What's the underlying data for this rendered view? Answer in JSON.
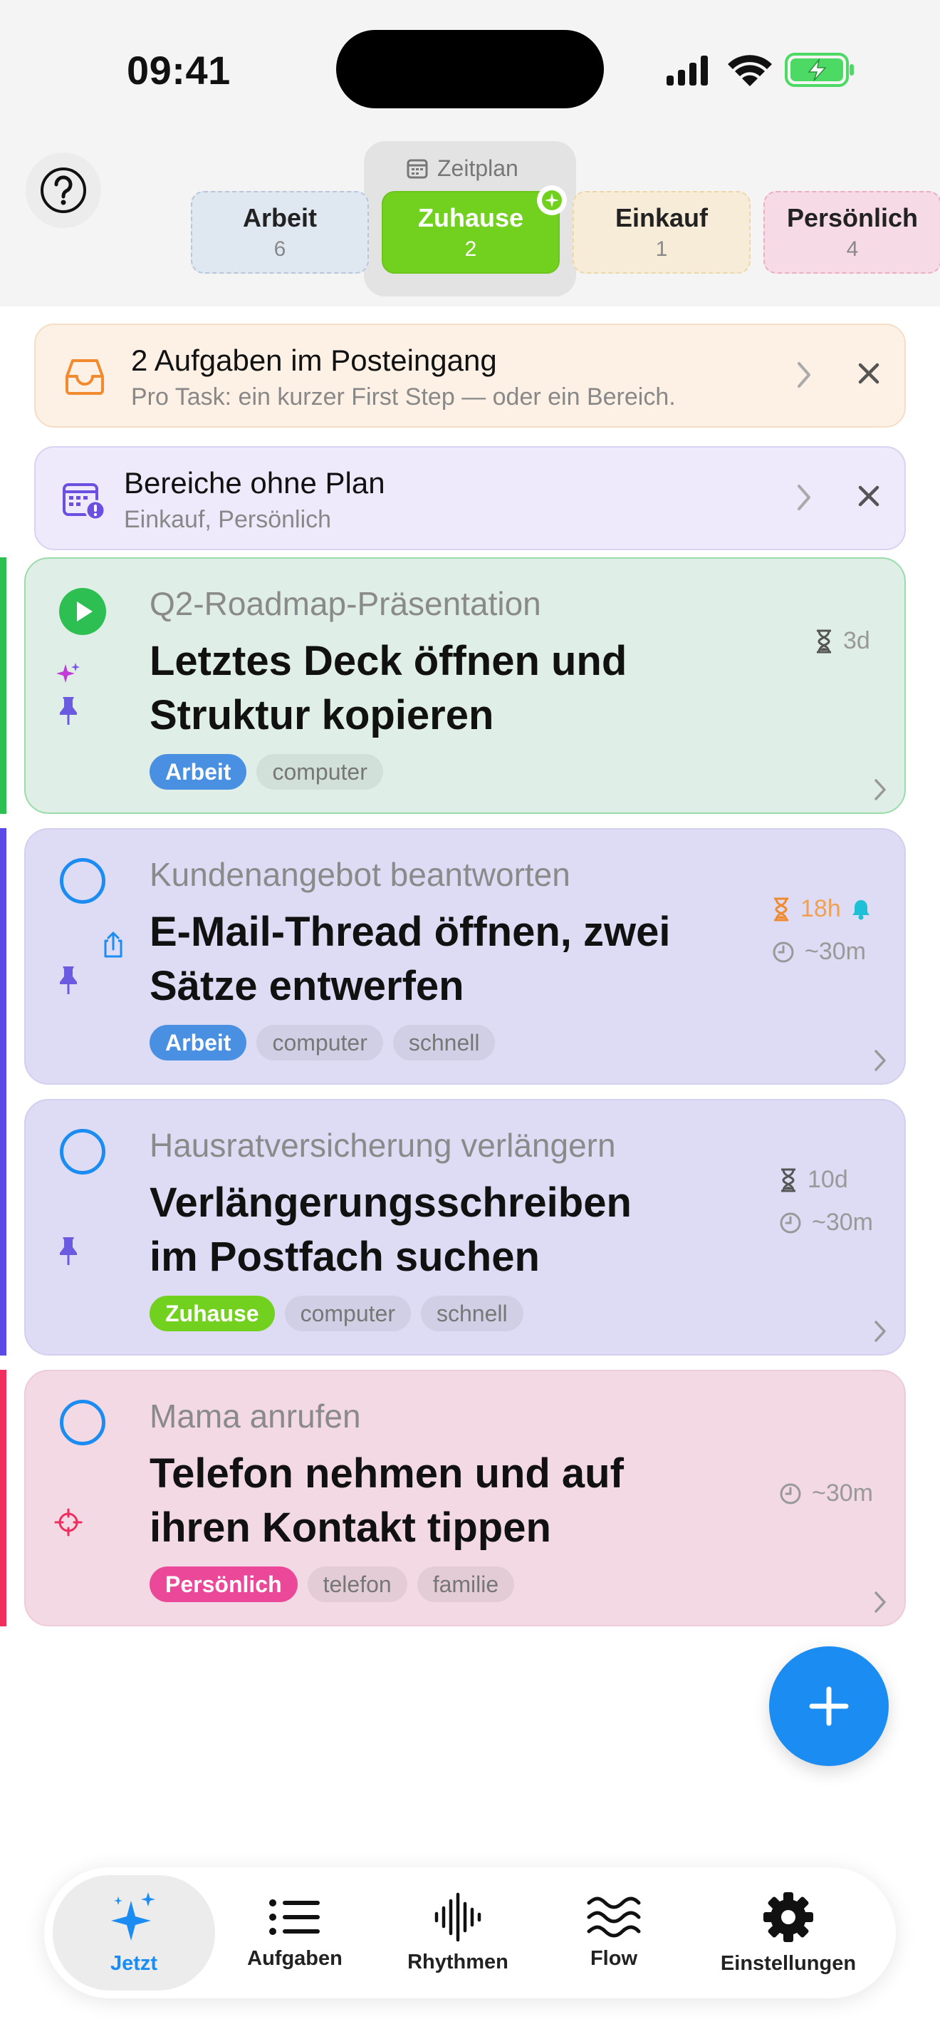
{
  "status_bar": {
    "time": "09:41"
  },
  "schedule": {
    "label": "Zeitplan",
    "contexts": [
      {
        "name": "Arbeit",
        "count": "6"
      },
      {
        "name": "Zuhause",
        "count": "2"
      },
      {
        "name": "Einkauf",
        "count": "1"
      },
      {
        "name": "Persönlich",
        "count": "4"
      }
    ],
    "active": "Zuhause"
  },
  "banners": {
    "inbox": {
      "title": "2 Aufgaben im Posteingang",
      "subtitle": "Pro Task: ein kurzer First Step — oder ein Bereich."
    },
    "plan": {
      "title": "Bereiche ohne Plan",
      "subtitle": "Einkauf, Persönlich"
    }
  },
  "tasks": [
    {
      "parent": "Q2-Roadmap-Präsentation",
      "step": "Letztes Deck öffnen und Struktur kopieren",
      "deadline": "3d",
      "tags": [
        "Arbeit",
        "computer"
      ],
      "state": "running"
    },
    {
      "parent": "Kundenangebot beantworten",
      "step": "E-Mail-Thread öffnen, zwei Sätze entwerfen",
      "deadline": "18h",
      "duration": "~30m",
      "tags": [
        "Arbeit",
        "computer",
        "schnell"
      ]
    },
    {
      "parent": "Hausratversicherung verlängern",
      "step": "Verlängerungsschreiben im Postfach suchen",
      "deadline": "10d",
      "duration": "~30m",
      "tags": [
        "Zuhause",
        "computer",
        "schnell"
      ]
    },
    {
      "parent": "Mama anrufen",
      "step": "Telefon nehmen und auf ihren Kontakt tippen",
      "duration": "~30m",
      "tags": [
        "Persönlich",
        "telefon",
        "familie"
      ]
    }
  ],
  "tabbar": {
    "items": [
      {
        "label": "Jetzt",
        "icon": "sparkles-icon"
      },
      {
        "label": "Aufgaben",
        "icon": "list-icon"
      },
      {
        "label": "Rhythmen",
        "icon": "waveform-icon"
      },
      {
        "label": "Flow",
        "icon": "waves-icon"
      },
      {
        "label": "Einstellungen",
        "icon": "gear-icon"
      }
    ],
    "active": "Jetzt"
  },
  "colors": {
    "accent": "#1a8cf2",
    "arbeit": "#4a90e2",
    "zuhause": "#72d01f",
    "persoenlich": "#ec4899",
    "running_green": "#2ebf52",
    "inbox_orange": "#f28b30",
    "plan_purple": "#6b4fe0"
  }
}
